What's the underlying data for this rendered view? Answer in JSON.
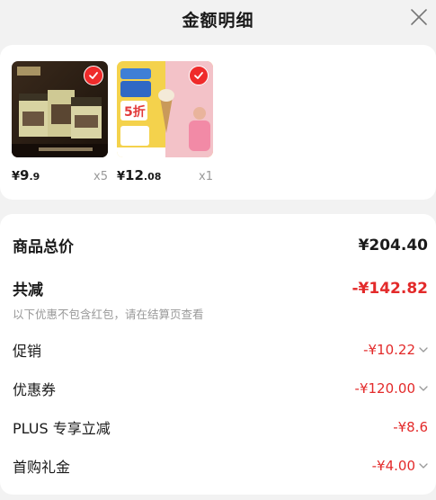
{
  "header": {
    "title": "金额明细"
  },
  "products": [
    {
      "image_label": "ice-cream-box-product-image",
      "price_currency": "¥",
      "price_int": "9",
      "price_dec": ".9",
      "quantity": "x5"
    },
    {
      "image_label": "ice-cream-cone-product-image",
      "price_currency": "¥",
      "price_int": "12",
      "price_dec": ".08",
      "quantity": "x1"
    }
  ],
  "summary": {
    "total_label": "商品总价",
    "total_value": "¥204.40",
    "reduce_label": "共减",
    "reduce_value": "-¥142.82",
    "reduce_note": "以下优惠不包含红包，请在结算页查看",
    "items": [
      {
        "label": "促销",
        "value": "-¥10.22",
        "expandable": true
      },
      {
        "label": "优惠券",
        "value": "-¥120.00",
        "expandable": true
      },
      {
        "label": "PLUS 专享立减",
        "value": "-¥8.6",
        "expandable": false
      },
      {
        "label": "首购礼金",
        "value": "-¥4.00",
        "expandable": true
      }
    ]
  },
  "colors": {
    "accent_red": "#e32a2a",
    "badge_red": "#ef2b2b",
    "background": "#f2f2f2"
  },
  "icons": {
    "close": "close-icon",
    "check": "check-icon",
    "chevron": "chevron-down-icon"
  }
}
